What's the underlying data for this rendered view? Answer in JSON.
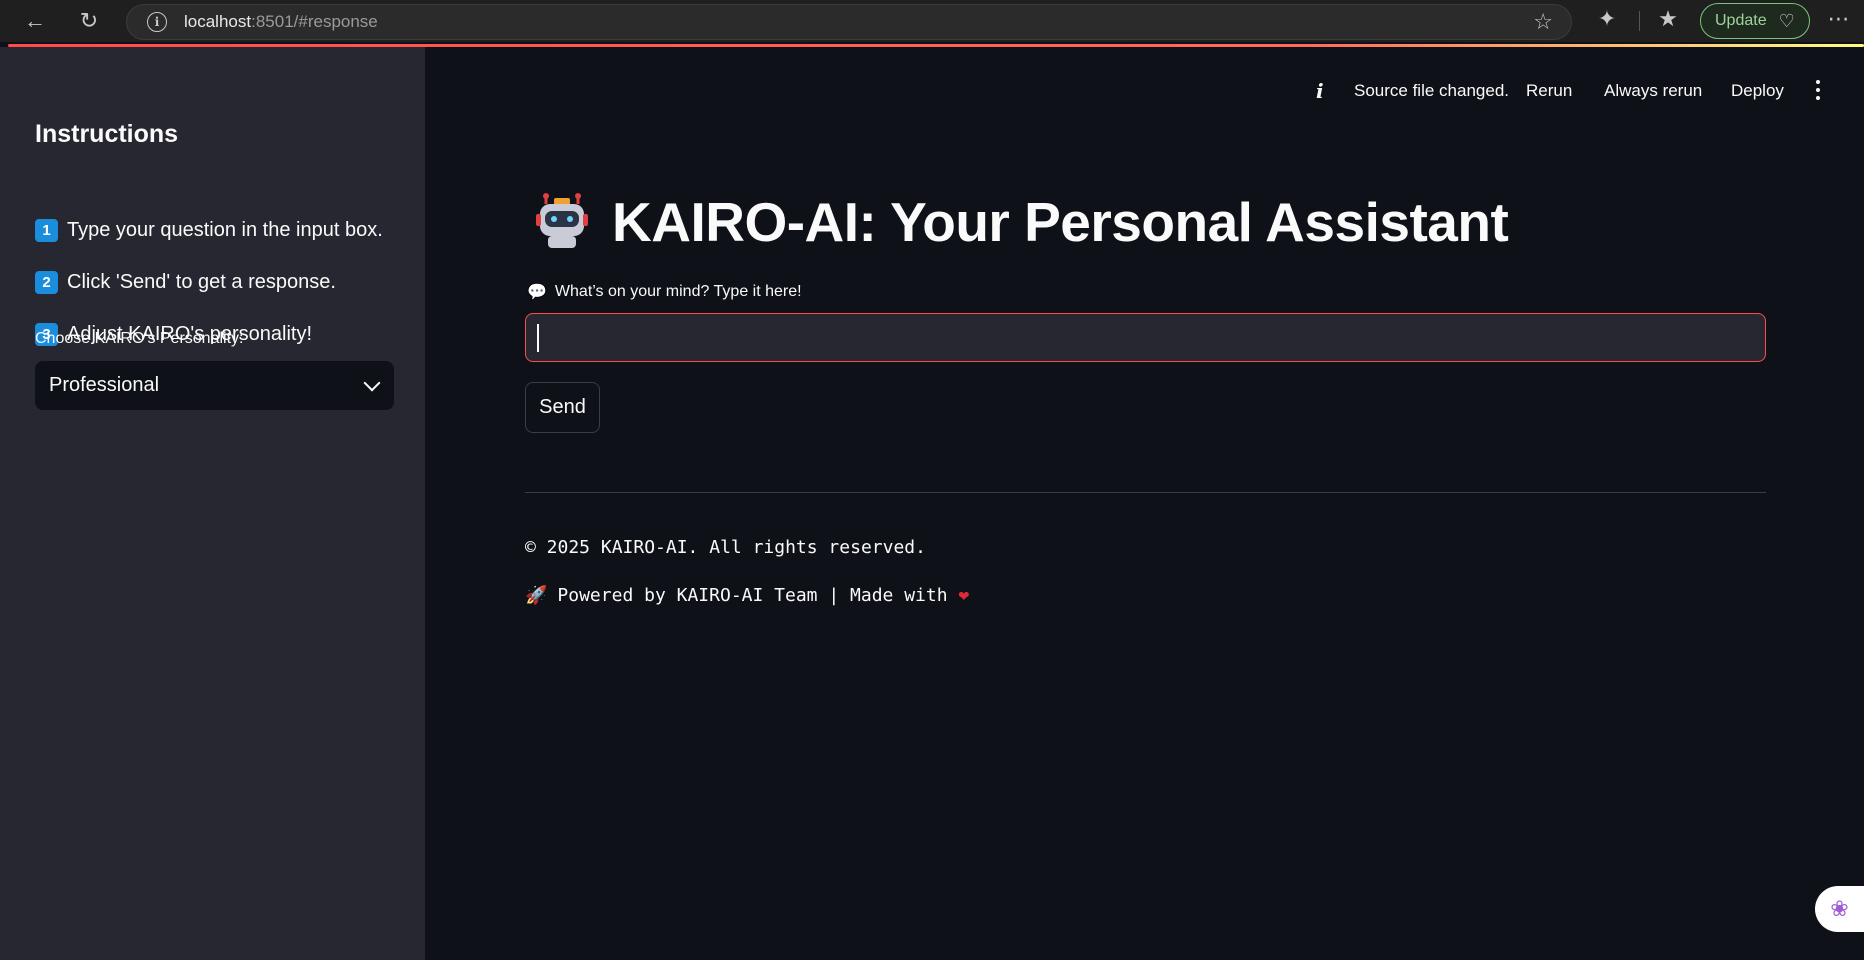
{
  "browser": {
    "url_host": "localhost",
    "url_rest": ":8501/#response",
    "update_label": "Update"
  },
  "toolbar": {
    "status_text": "Source file changed.",
    "rerun_label": "Rerun",
    "always_rerun_label": "Always rerun",
    "deploy_label": "Deploy"
  },
  "sidebar": {
    "title": "Instructions",
    "instructions": [
      {
        "num": "1",
        "text": "Type your question in the input box."
      },
      {
        "num": "2",
        "text": "Click 'Send' to get a response."
      },
      {
        "num": "3",
        "text": "Adjust KAIRO's personality!"
      }
    ],
    "select_label": "Choose KAIRO's Personality:",
    "select_value": "Professional"
  },
  "main": {
    "title": "KAIRO-AI: Your Personal Assistant",
    "input_label": "What’s on your mind? Type it here!",
    "input_value": "",
    "send_label": "Send",
    "footer_copyright": "© 2025 KAIRO-AI. All rights reserved.",
    "footer_powered": "Powered by KAIRO-AI Team | Made with"
  },
  "colors": {
    "accent": "#ff4b4b",
    "sidebar_bg": "#262730",
    "main_bg": "#0e1117",
    "badge": "#1a8ddd"
  },
  "icons": [
    "back-icon",
    "reload-icon",
    "info-icon",
    "star-icon",
    "extensions-icon",
    "favorites-icon",
    "health-icon",
    "more-icon",
    "robot-icon",
    "speech-bubble-icon",
    "rocket-icon",
    "heart-icon",
    "brain-icon",
    "chevron-down-icon",
    "kebab-menu-icon"
  ]
}
